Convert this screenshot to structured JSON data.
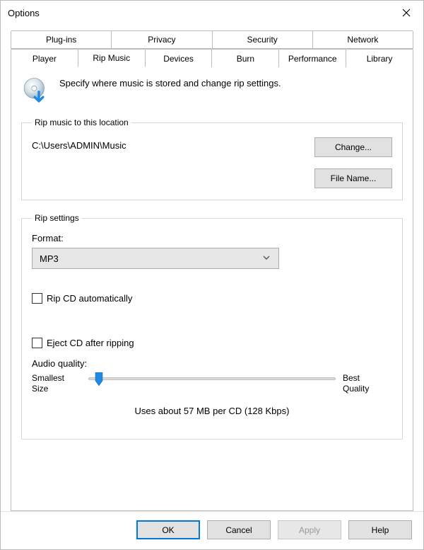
{
  "window": {
    "title": "Options"
  },
  "tabs": {
    "row1": [
      "Plug-ins",
      "Privacy",
      "Security",
      "Network"
    ],
    "row2": [
      "Player",
      "Rip Music",
      "Devices",
      "Burn",
      "Performance",
      "Library"
    ],
    "active": "Rip Music"
  },
  "header": {
    "text": "Specify where music is stored and change rip settings."
  },
  "location_group": {
    "legend": "Rip music to this location",
    "path": "C:\\Users\\ADMIN\\Music",
    "change_label": "Change...",
    "filename_label": "File Name..."
  },
  "rip_group": {
    "legend": "Rip settings",
    "format_label": "Format:",
    "format_value": "MP3",
    "rip_auto_label": "Rip CD automatically",
    "rip_auto_checked": false,
    "eject_label": "Eject CD after ripping",
    "eject_checked": false,
    "audio_quality_label": "Audio quality:",
    "slider_left_line1": "Smallest",
    "slider_left_line2": "Size",
    "slider_right_line1": "Best",
    "slider_right_line2": "Quality",
    "slider_help": "Uses about 57 MB per CD (128 Kbps)"
  },
  "buttons": {
    "ok": "OK",
    "cancel": "Cancel",
    "apply": "Apply",
    "help": "Help"
  }
}
